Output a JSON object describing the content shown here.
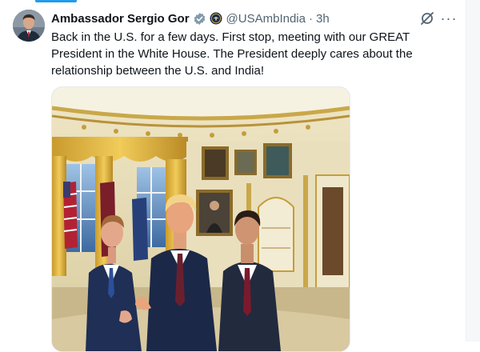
{
  "tweet": {
    "display_name": "Ambassador Sergio Gor",
    "handle": "@USAmbIndia",
    "separator": "·",
    "time": "3h",
    "text": "Back in the U.S. for a few days. First stop, meeting with our GREAT President in the White House. The President deeply cares about the relationship between the U.S. and India!",
    "more_label": "···"
  },
  "colors": {
    "accent": "#1d9bf0",
    "text_secondary": "#536471",
    "verified_badge": "#829aab"
  },
  "icons": {
    "verified": "verified-badge-icon",
    "seal": "government-seal-icon",
    "grok": "grok-icon",
    "more": "more-icon"
  }
}
